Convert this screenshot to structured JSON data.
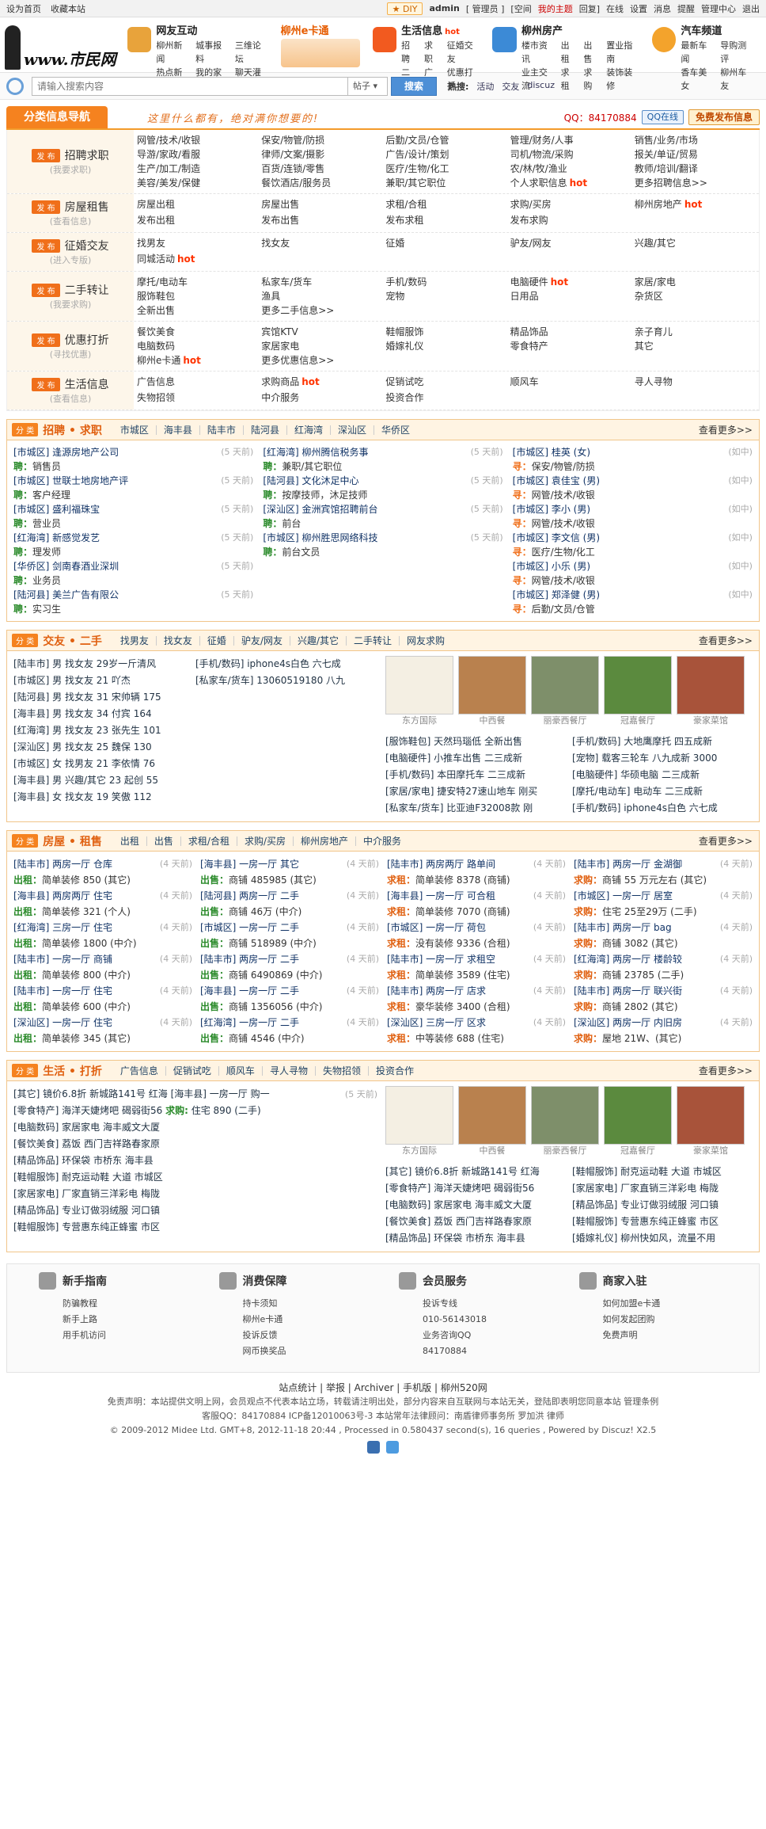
{
  "topbar": {
    "set_home": "设为首页",
    "bookmark": "收藏本站",
    "diy": "DIY",
    "user": "admin",
    "admin_panel": "[ 管理员 ]",
    "space": "[空间",
    "my_topics": "我的主题",
    "reply": "回复]",
    "online": "在线",
    "settings": "设置",
    "messages": "消息",
    "reminders": "提醒",
    "manage": "管理中心",
    "logout": "退出"
  },
  "logo": {
    "text": "www.市民网"
  },
  "nav": [
    {
      "title": "网友互动",
      "color": "#e8a33b",
      "rows": [
        [
          "柳州新闻",
          "城事报料",
          "三维论坛"
        ],
        [
          "热点新闻",
          "我的家园",
          "聊天灌水"
        ]
      ]
    },
    {
      "title": "柳州e卡通",
      "orange": true,
      "rows": [],
      "icon_only": true
    },
    {
      "title": "生活信息",
      "hot": "hot",
      "color": "#f25a1f",
      "rows": [
        [
          "招聘",
          "求职",
          "征婚交友"
        ],
        [
          "二手",
          "广告",
          "优惠打折"
        ]
      ]
    },
    {
      "title": "柳州房产",
      "color": "#3c8ad6",
      "rows": [
        [
          "楼市资讯",
          "出租",
          "出售",
          "置业指南"
        ],
        [
          "业主交流",
          "求租",
          "求购",
          "装饰装修"
        ]
      ]
    },
    {
      "title": "汽车频道",
      "color": "#f3a32c",
      "rows": [
        [
          "最新车闻",
          "导购测评"
        ],
        [
          "香车美女",
          "柳州车友"
        ]
      ]
    }
  ],
  "search": {
    "placeholder": "请输入搜索内容",
    "type": "帖子",
    "button": "搜索",
    "hot_label": "热搜:",
    "hot": [
      "活动",
      "交友",
      "discuz"
    ]
  },
  "catbar": {
    "tab": "分类信息导航",
    "slogan": "这里什么都有，绝对满你想要的!",
    "qq": "QQ：84170884",
    "qq_btn": "QQ在线",
    "publish": "免费发布信息"
  },
  "categories": [
    {
      "name": "招聘求职",
      "sub": "(我要求职)",
      "links": [
        "网管/技术/收银",
        "保安/物管/防损",
        "后勤/文员/仓管",
        "管理/财务/人事",
        "销售/业务/市场",
        "导游/家政/看服",
        "律师/文案/摄影",
        "广告/设计/策划",
        "司机/物流/采购",
        "报关/单证/贸易",
        "生产/加工/制造",
        "百货/连锁/零售",
        "医疗/生物/化工",
        "农/林/牧/渔业",
        "教师/培训/翻译",
        "美容/美发/保健",
        "餐饮酒店/服务员",
        "兼职/其它职位",
        "个人求职信息 hot",
        "更多招聘信息>>"
      ]
    },
    {
      "name": "房屋租售",
      "sub": "(查看信息)",
      "links": [
        "房屋出租",
        "房屋出售",
        "求租/合租",
        "求购/买房",
        "柳州房地产 hot",
        "发布出租",
        "发布出售",
        "发布求租",
        "发布求购",
        ""
      ]
    },
    {
      "name": "征婚交友",
      "sub": "(进入专版)",
      "links": [
        "找男友",
        "找女友",
        "征婚",
        "驴友/网友",
        "兴趣/其它",
        "同城活动 hot",
        "",
        "",
        "",
        ""
      ]
    },
    {
      "name": "二手转让",
      "sub": "(我要求购)",
      "links": [
        "摩托/电动车",
        "私家车/货车",
        "手机/数码",
        "电脑硬件 hot",
        "家居/家电",
        "服饰鞋包",
        "渔具",
        "宠物",
        "日用品",
        "杂货区",
        "全新出售",
        "更多二手信息>>",
        "",
        "",
        ""
      ]
    },
    {
      "name": "优惠打折",
      "sub": "(寻找优惠)",
      "links": [
        "餐饮美食",
        "宾馆KTV",
        "鞋帽服饰",
        "精品饰品",
        "亲子育儿",
        "电脑数码",
        "家居家电",
        "婚嫁礼仪",
        "零食特产",
        "其它",
        "柳州e卡通 hot",
        "更多优惠信息>>",
        "",
        "",
        ""
      ]
    },
    {
      "name": "生活信息",
      "sub": "(查看信息)",
      "links": [
        "广告信息",
        "求购商品 hot",
        "促销试吃",
        "顺风车",
        "寻人寻物",
        "失物招领",
        "中介服务",
        "投资合作",
        "",
        ""
      ]
    }
  ],
  "jobs": {
    "badge": "分 类",
    "title": "招聘 • 求职",
    "tabs": [
      "市城区",
      "海丰县",
      "陆丰市",
      "陆河县",
      "红海湾",
      "深汕区",
      "华侨区"
    ],
    "more": "查看更多>>",
    "col1": [
      [
        "[市城区] 逢源房地产公司",
        "(5 天前)",
        "聘",
        "销售员"
      ],
      [
        "[市城区] 世联士地房地产评",
        "(5 天前)",
        "聘",
        "客户经理"
      ],
      [
        "[市城区] 盛利福珠宝",
        "(5 天前)",
        "聘",
        "营业员"
      ],
      [
        "[红海湾] 新感觉发艺",
        "(5 天前)",
        "聘",
        "理发师"
      ],
      [
        "[华侨区] 剑南春酒业深圳",
        "(5 天前)",
        "聘",
        "业务员"
      ],
      [
        "[陆河县] 美兰广告有限公",
        "(5 天前)",
        "聘",
        "实习生"
      ]
    ],
    "col2": [
      [
        "[红海湾] 柳州腾信税务事",
        "(5 天前)",
        "聘",
        "兼职/其它职位"
      ],
      [
        "[陆河县] 文化沐足中心",
        "(5 天前)",
        "聘",
        "按摩技师，沐足技师"
      ],
      [
        "[深汕区] 金洲宾馆招聘前台",
        "(5 天前)",
        "聘",
        "前台"
      ],
      [
        "[市城区] 柳州胜思网络科技",
        "(5 天前)",
        "聘",
        "前台文员"
      ]
    ],
    "col3": [
      [
        "[市城区] 桂英 (女)",
        "(如中)",
        "寻",
        "保安/物管/防损"
      ],
      [
        "[市城区] 袁佳宝 (男)",
        "(如中)",
        "寻",
        "网管/技术/收银"
      ],
      [
        "[市城区] 李小 (男)",
        "(如中)",
        "寻",
        "网管/技术/收银"
      ],
      [
        "[市城区] 李文信 (男)",
        "(如中)",
        "寻",
        "医疗/生物/化工"
      ],
      [
        "[市城区] 小乐 (男)",
        "(如中)",
        "寻",
        "网管/技术/收银"
      ],
      [
        "[市城区] 郑泽健 (男)",
        "(如中)",
        "寻",
        "后勤/文员/仓管"
      ]
    ]
  },
  "friends": {
    "badge": "分 类",
    "title": "交友 • 二手",
    "tabs": [
      "找男友",
      "找女友",
      "征婚",
      "驴友/网友",
      "兴趣/其它",
      "二手转让",
      "网友求购"
    ],
    "more": "查看更多>>",
    "left": [
      "[陆丰市] 男 找女友 29岁一斤清风",
      "[市城区] 男 找女友 21 吖杰",
      "[陆河县] 男 找女友 31 宋帅辆 175",
      "[海丰县] 男 找女友 34 付宾 164",
      "[红海湾] 男 找女友 23 张先生 101",
      "[深汕区] 男 找女友 25 魏保 130",
      "[市城区] 女 找男友 21 李依情 76",
      "[海丰县] 男 兴趣/其它 23 起创 55",
      "[海丰县] 女 找女友 19 笑傲 112"
    ],
    "mid": [
      "[手机/数码] iphone4s白色 六七成",
      "[私家车/货车] 13060519180 八九"
    ],
    "photos": [
      "东方国际",
      "中西餐",
      "丽豪西餐厅",
      "冠嘉餐厅",
      "豪家菜馆"
    ],
    "grid": [
      "[服饰鞋包] 天然玛瑙低 全新出售",
      "[手机/数码] 大地鹰摩托 四五成新",
      "[电脑硬件] 小推车出售 二三成新",
      "[宠物] 载客三轮车 八九成新 3000",
      "[手机/数码] 本田摩托车 二三成新",
      "[电脑硬件] 华硕电脑 二三成新",
      "[家居/家电] 捷安特27速山地车 刚买",
      "[摩托/电动车] 电动车 二三成新",
      "[私家车/货车] 比亚迪F32008款 刚",
      "[手机/数码] iphone4s白色 六七成"
    ]
  },
  "house": {
    "badge": "分 类",
    "title": "房屋 • 租售",
    "tabs": [
      "出租",
      "出售",
      "求租/合租",
      "求购/买房",
      "柳州房地产",
      "中介服务"
    ],
    "more": "查看更多>>",
    "items": [
      [
        "[陆丰市] 两房一厅 仓库",
        "(4 天前)",
        "出租",
        "简单装修 850 (其它)"
      ],
      [
        "[海丰县] 一房一厅 其它",
        "(4 天前)",
        "出售",
        "商铺 485985 (其它)"
      ],
      [
        "[陆丰市] 两房两厅 路单间",
        "(4 天前)",
        "求租",
        "简单装修 8378 (商铺)"
      ],
      [
        "[陆丰市] 两房一厅 金湖御",
        "(4 天前)",
        "求购",
        "商铺 55 万元左右 (其它)"
      ],
      [
        "[海丰县] 两房两厅 住宅",
        "(4 天前)",
        "出租",
        "简单装修 321 (个人)"
      ],
      [
        "[陆河县] 两房一厅 二手",
        "(4 天前)",
        "出售",
        "商铺 46万 (中介)"
      ],
      [
        "[海丰县] 一房一厅 可合租",
        "(4 天前)",
        "求租",
        "简单装修 7070 (商铺)"
      ],
      [
        "[市城区] 一房一厅 居室",
        "(4 天前)",
        "求购",
        "住宅 25至29万 (二手)"
      ],
      [
        "[红海湾] 三房一厅 住宅",
        "(4 天前)",
        "出租",
        "简单装修 1800 (中介)"
      ],
      [
        "[市城区] 一房一厅 二手",
        "(4 天前)",
        "出售",
        "商铺 518989 (中介)"
      ],
      [
        "[市城区] 一房一厅 荷包",
        "(4 天前)",
        "求租",
        "没有装修 9336 (合租)"
      ],
      [
        "[陆丰市] 两房一厅 bag",
        "(4 天前)",
        "求购",
        "商铺 3082 (其它)"
      ],
      [
        "[陆丰市] 一房一厅 商铺",
        "(4 天前)",
        "出租",
        "简单装修 800 (中介)"
      ],
      [
        "[陆丰市] 两房一厅 二手",
        "(4 天前)",
        "出售",
        "商铺 6490869 (中介)"
      ],
      [
        "[陆丰市] 一房一厅 求租空",
        "(4 天前)",
        "求租",
        "简单装修 3589 (住宅)"
      ],
      [
        "[红海湾] 两房一厅 楼龄较",
        "(4 天前)",
        "求购",
        "商铺 23785 (二手)"
      ],
      [
        "[陆丰市] 一房一厅 住宅",
        "(4 天前)",
        "出租",
        "简单装修 600 (中介)"
      ],
      [
        "[海丰县] 一房一厅 二手",
        "(4 天前)",
        "出售",
        "商铺 1356056 (中介)"
      ],
      [
        "[陆丰市] 两房一厅 店求",
        "(4 天前)",
        "求租",
        "豪华装修 3400 (合租)"
      ],
      [
        "[陆丰市] 两房一厅 联兴街",
        "(4 天前)",
        "求购",
        "商铺 2802 (其它)"
      ],
      [
        "[深汕区] 一房一厅 住宅",
        "(4 天前)",
        "出租",
        "简单装修 345 (其它)"
      ],
      [
        "[红海湾] 一房一厅 二手",
        "(4 天前)",
        "出售",
        "商铺 4546 (中介)"
      ],
      [
        "[深汕区] 三房一厅 区求",
        "(4 天前)",
        "求租",
        "中等装修 688 (住宅)"
      ],
      [
        "[深汕区] 两房一厅 内旧房",
        "(4 天前)",
        "求购",
        "屋地 21W、(其它)"
      ]
    ]
  },
  "life": {
    "badge": "分 类",
    "title": "生活 • 打折",
    "tabs": [
      "广告信息",
      "促销试吃",
      "顺风车",
      "寻人寻物",
      "失物招领",
      "投资合作"
    ],
    "more": "查看更多>>",
    "left": [
      "[其它] 镜价6.8折 新城路141号 红海 [海丰县] 一房一厅 购一",
      "[零食特产] 海洋天婕烤吧 碣弱街56",
      "[电脑数码] 家居家电 海丰威文大厦",
      "[餐饮美食] 荔饭 西门吉祥路春家原",
      "[精品饰品] 环保袋 市桥东 海丰县",
      "[鞋帽服饰] 耐克运动鞋 大道 市城区",
      "[家居家电] 厂家直销三洋彩电 梅陇",
      "[精品饰品] 专业订做羽绒服 河口镇",
      "[鞋帽服饰] 专营惠东纯正蜂蜜 市区"
    ],
    "left_extra": {
      "date": "(5 天前)",
      "label": "求购:",
      "text": "住宅 890 (二手)"
    },
    "photos": [
      "东方国际",
      "中西餐",
      "丽豪西餐厅",
      "冠嘉餐厅",
      "豪家菜馆"
    ],
    "grid": [
      "[其它] 镜价6.8折 新城路141号 红海",
      "[鞋帽服饰] 耐克运动鞋 大道 市城区",
      "[零食特产] 海洋天婕烤吧 碣弱街56",
      "[家居家电] 厂家直销三洋彩电 梅陇",
      "[电脑数码] 家居家电 海丰威文大厦",
      "[精品饰品] 专业订做羽绒服 河口镇",
      "[餐饮美食] 荔饭 西门吉祥路春家原",
      "[鞋帽服饰] 专营惠东纯正蜂蜜 市区",
      "[精品饰品] 环保袋 市桥东 海丰县",
      "[婚嫁礼仪] 柳州快如风，流量不用"
    ]
  },
  "footer": [
    {
      "title": "新手指南",
      "links": [
        "防骗教程",
        "新手上路",
        "用手机访问"
      ]
    },
    {
      "title": "消费保障",
      "links": [
        "持卡须知",
        "柳州e卡通",
        "投诉反馈",
        "网币换奖品"
      ]
    },
    {
      "title": "会员服务",
      "links": [
        "投诉专线",
        "010-56143018",
        "业务咨询QQ",
        "84170884"
      ]
    },
    {
      "title": "商家入驻",
      "links": [
        "如何加盟e卡通",
        "如何发起团购",
        "免费声明"
      ]
    }
  ],
  "bottom": {
    "links": [
      "站点统计",
      "举报",
      "Archiver",
      "手机版",
      "柳州520网"
    ],
    "disclaimer": "免责声明：本站提供文明上网，会员观点不代表本站立场，转载请注明出处，部分内容来自互联网与本站无关，登陆即表明您同意本站 管理条例",
    "contact": "客服QQ：84170884 ICP备12010063号-3 本站常年法律顾问：南盾律师事务所 罗加洪 律师",
    "copyright": "© 2009-2012 Midee Ltd. GMT+8, 2012-11-18 20:44 , Processed in 0.580437 second(s), 16 queries , Powered by Discuz! X2.5"
  }
}
